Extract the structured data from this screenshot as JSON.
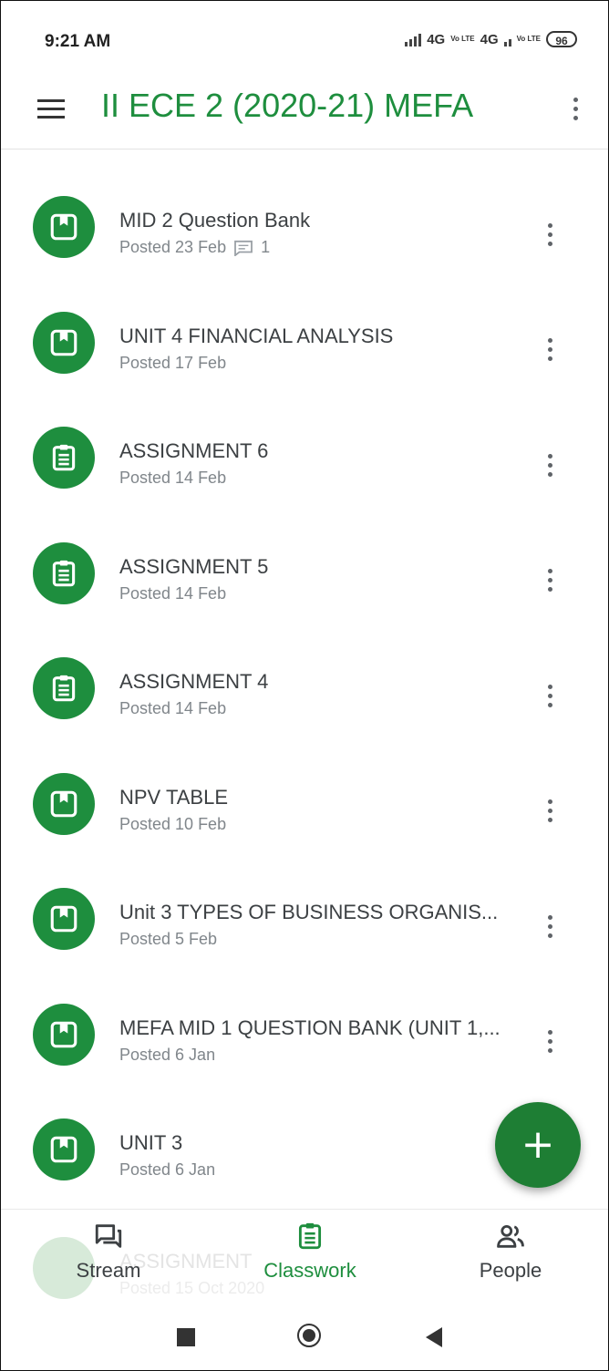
{
  "status_bar": {
    "time": "9:21 AM",
    "network_1": "4G",
    "network_2": "4G",
    "volte_1": "Vo LTE",
    "volte_2": "Vo LTE",
    "battery": "96"
  },
  "app_bar": {
    "title": "II ECE 2 (2020-21)  MEFA",
    "menu_icon": "hamburger-menu-icon",
    "overflow_icon": "more-vert-icon"
  },
  "items": [
    {
      "title": "MID 2 Question Bank",
      "posted": "Posted 23 Feb",
      "comments": "1",
      "icon": "material-icon"
    },
    {
      "title": "UNIT 4 FINANCIAL ANALYSIS",
      "posted": "Posted 17 Feb",
      "icon": "material-icon"
    },
    {
      "title": "ASSIGNMENT 6",
      "posted": "Posted 14 Feb",
      "icon": "assignment-icon"
    },
    {
      "title": "ASSIGNMENT 5",
      "posted": "Posted 14 Feb",
      "icon": "assignment-icon"
    },
    {
      "title": "ASSIGNMENT 4",
      "posted": "Posted 14 Feb",
      "icon": "assignment-icon"
    },
    {
      "title": "NPV TABLE",
      "posted": "Posted 10 Feb",
      "icon": "material-icon"
    },
    {
      "title": "Unit 3 TYPES OF BUSINESS ORGANIS...",
      "posted": "Posted 5 Feb",
      "icon": "material-icon"
    },
    {
      "title": "MEFA MID 1 QUESTION BANK (UNIT 1,...",
      "posted": "Posted 6 Jan",
      "icon": "material-icon"
    },
    {
      "title": "UNIT 3",
      "posted": "Posted 6 Jan",
      "icon": "material-icon"
    }
  ],
  "partially_hidden_item": {
    "title": "ASSIGNMENT",
    "posted": "Posted 15 Oct 2020"
  },
  "fab": {
    "label": "+"
  },
  "bottom_nav": [
    {
      "label": "Stream",
      "icon": "stream-icon",
      "active": false
    },
    {
      "label": "Classwork",
      "icon": "classwork-icon",
      "active": true
    },
    {
      "label": "People",
      "icon": "people-icon",
      "active": false
    }
  ],
  "colors": {
    "accent": "#1e8e3e",
    "text": "#3c4043",
    "secondary": "#80868b"
  }
}
